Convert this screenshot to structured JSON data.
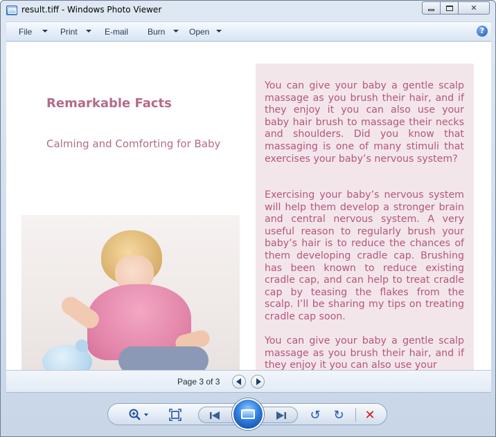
{
  "window": {
    "title": "result.tiff - Windows Photo Viewer",
    "app_icon": "photo-viewer-icon"
  },
  "menubar": {
    "items": [
      {
        "label": "File",
        "has_dropdown": true
      },
      {
        "label": "Print",
        "has_dropdown": true
      },
      {
        "label": "E-mail",
        "has_dropdown": false
      },
      {
        "label": "Burn",
        "has_dropdown": true
      },
      {
        "label": "Open",
        "has_dropdown": true
      }
    ],
    "help_label": "?"
  },
  "document": {
    "title": "Remarkable Facts",
    "subtitle": "Calming and Comforting for Baby",
    "paragraphs": [
      "You can give your baby a gentle scalp massage as you brush their hair, and if they enjoy it you can also use your baby hair brush to massage their necks and shoulders. Did you know that massaging is one of many stimuli that exercises your baby’s nervous system?",
      "Exercising your baby’s nervous system will help them develop a stronger brain and central nervous system. A very useful reason to regularly brush your baby’s hair is to reduce the chances of them developing cradle cap. Brushing has been known to reduce existing cradle cap, and can help to treat cradle cap by teasing the flakes from the scalp. I’ll be sharing my tips on treating cradle cap soon.",
      "You can give your baby a gentle scalp massage as you brush their hair, and if they enjoy it you can also use your"
    ],
    "text_color": "#b5557f",
    "panel_color": "#f3e6ea"
  },
  "statusbar": {
    "page_label": "Page 3 of 3"
  },
  "controls": {
    "zoom_icon": "zoom-icon",
    "fit_icon": "actual-size-icon",
    "prev_icon": "previous-icon",
    "slideshow_icon": "slideshow-icon",
    "next_icon": "next-icon",
    "rotate_ccw_icon": "rotate-counterclockwise-icon",
    "rotate_cw_icon": "rotate-clockwise-icon",
    "delete_icon": "delete-icon"
  }
}
